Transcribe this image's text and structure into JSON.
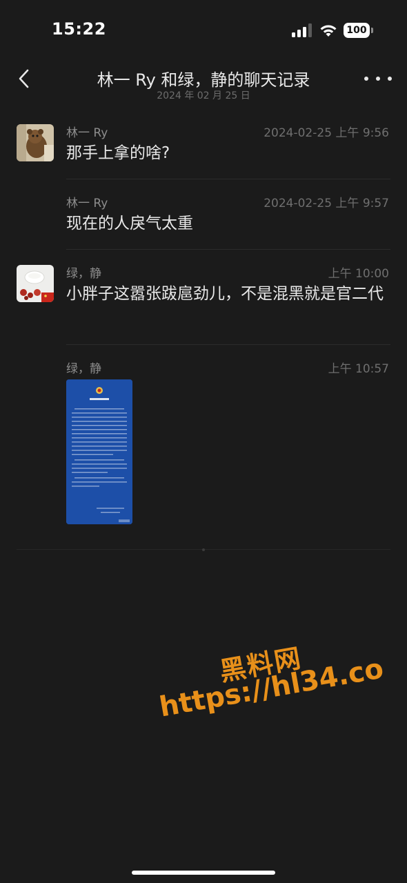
{
  "status_bar": {
    "time": "15:22",
    "battery": "100",
    "signal_icon": "cellular-signal-icon",
    "wifi_icon": "wifi-icon"
  },
  "header": {
    "title": "林一 Ry 和绿，静的聊天记录",
    "subtitle": "2024 年 02 月 25 日",
    "back_icon": "chevron-left-icon",
    "more_icon": "more-dots-icon"
  },
  "messages": [
    {
      "sender": "林一 Ry",
      "time": "2024-02-25 上午 9:56",
      "text": "那手上拿的啥?",
      "has_avatar": true
    },
    {
      "sender": "林一 Ry",
      "time": "2024-02-25 上午 9:57",
      "text": "现在的人戾气太重",
      "has_avatar": false
    },
    {
      "sender": "绿，静",
      "time": "上午 10:00",
      "text": "小胖子这嚣张跋扈劲儿，不是混黑就是官二代",
      "has_avatar": true
    },
    {
      "sender": "绿，静",
      "time": "上午 10:57",
      "text": "",
      "has_avatar": false,
      "attachment": "police-notice-image"
    }
  ],
  "watermark": {
    "title": "黑料网",
    "url": "https://hl34.co"
  },
  "colors": {
    "background": "#1b1b1b",
    "watermark": "#e8901a",
    "notice_blue": "#1d4fa8"
  }
}
